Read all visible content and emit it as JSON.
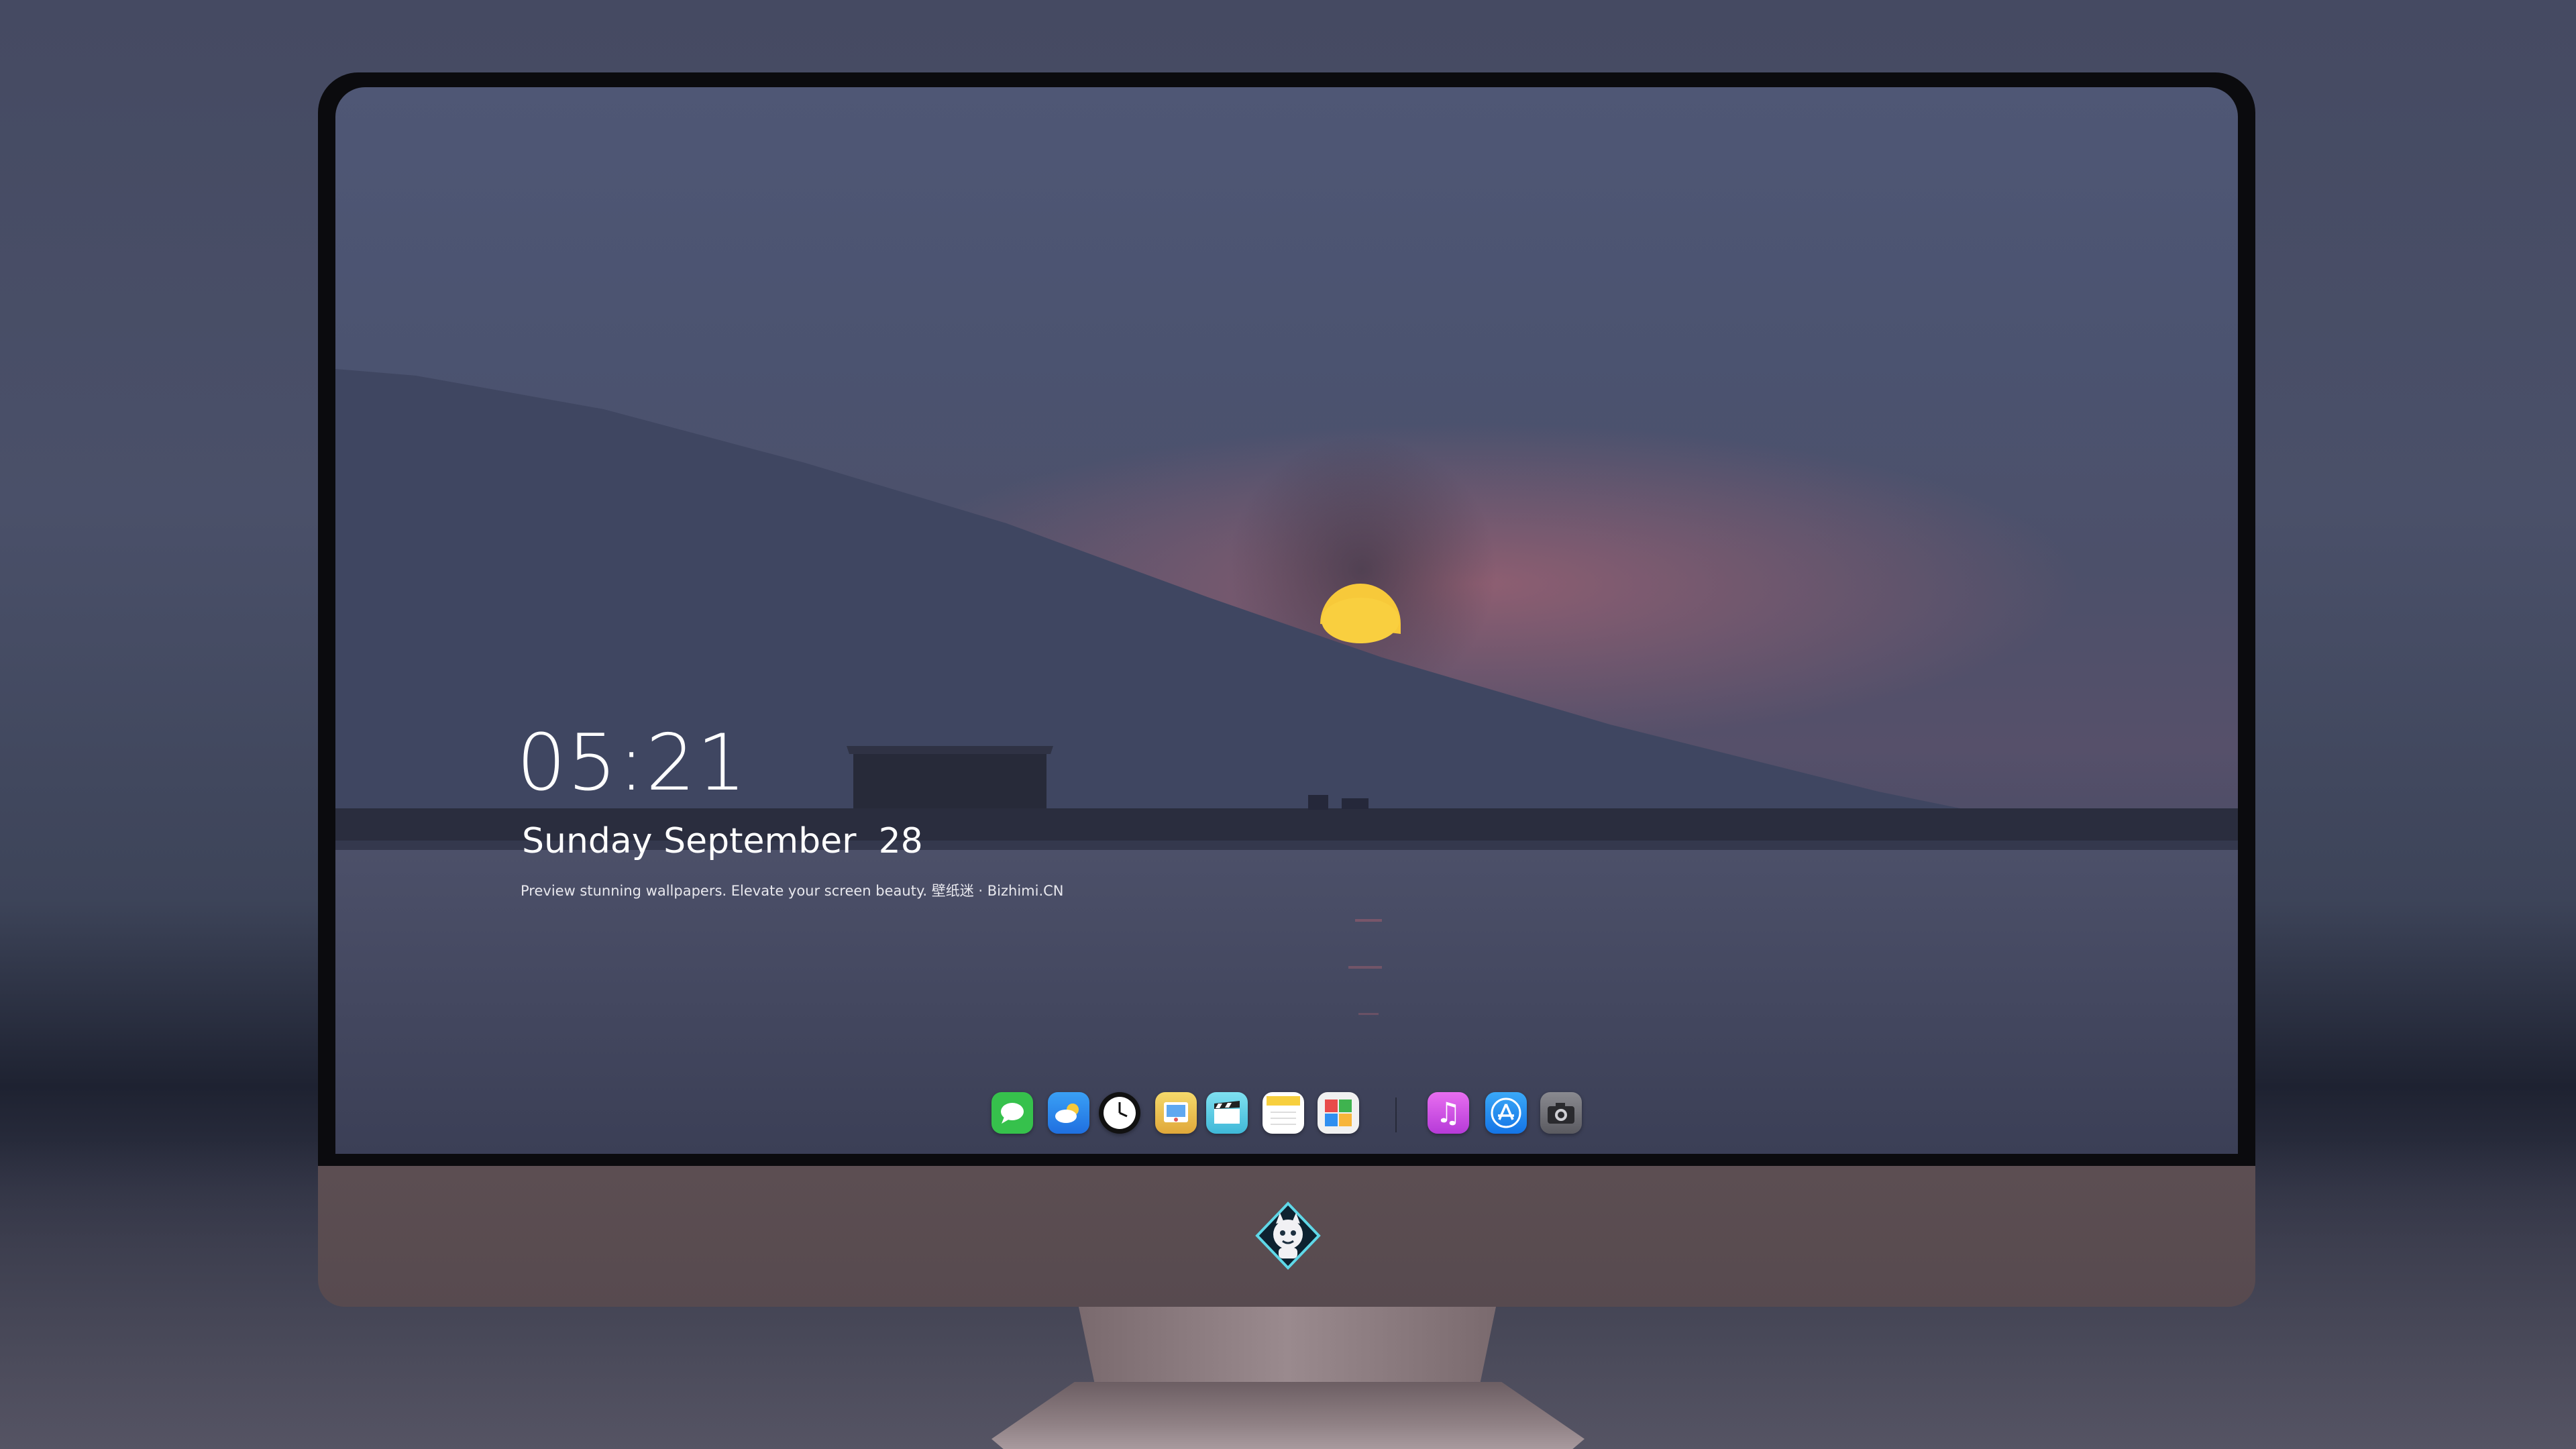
{
  "lockscreen": {
    "time": "05:21",
    "date": "Sunday September  28",
    "tagline": "Preview stunning wallpapers. Elevate your screen beauty. 壁纸迷 · Bizhimi.CN"
  },
  "dock": {
    "apps": [
      {
        "name": "messages-icon",
        "color": "#37c24a"
      },
      {
        "name": "weather-icon",
        "color": "#2f8ff0"
      },
      {
        "name": "clock-icon",
        "color": "#111111"
      },
      {
        "name": "preview-icon",
        "color": "#f2c94c"
      },
      {
        "name": "video-clips-icon",
        "color": "#5fd3e8"
      },
      {
        "name": "notes-icon",
        "color": "#f7d048"
      },
      {
        "name": "photo-booth-icon",
        "color": "#f0f0f0"
      },
      {
        "name": "music-icon",
        "color": "#d24be0"
      },
      {
        "name": "app-store-icon",
        "color": "#1a8cf0"
      },
      {
        "name": "camera-icon",
        "color": "#6b6b70"
      }
    ]
  },
  "monitor": {
    "logo": "mascot-logo-icon"
  }
}
